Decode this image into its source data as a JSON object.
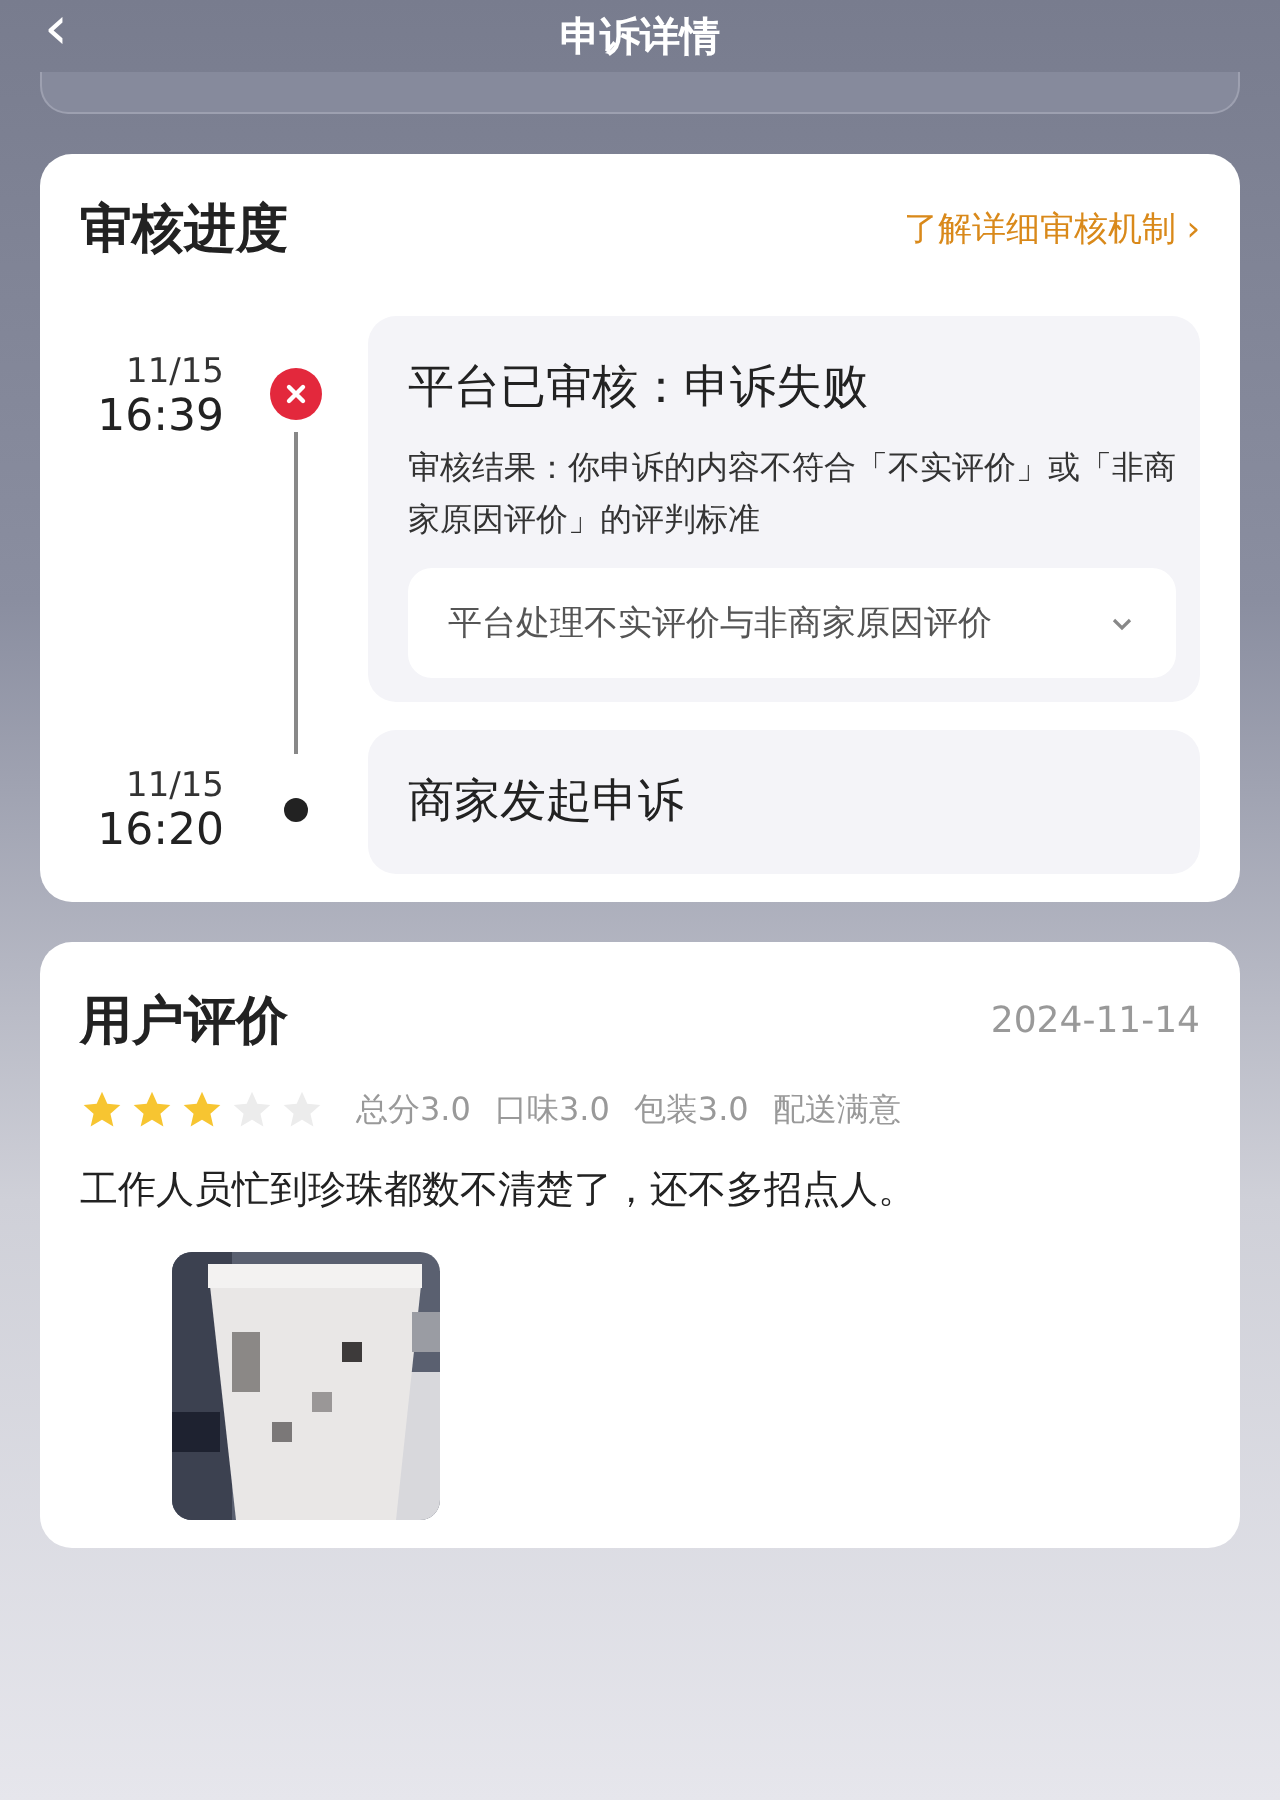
{
  "header": {
    "back": "‹",
    "title": "申诉详情"
  },
  "review_progress": {
    "title": "审核进度",
    "link": "了解详细审核机制 ›",
    "events": [
      {
        "date": "11/15",
        "time": "16:39",
        "kind": "failed",
        "title": "平台已审核：申诉失败",
        "detail": "审核结果：你申诉的内容不符合「不实评价」或「非商家原因评价」的评判标准",
        "dropdown": {
          "label": "平台处理不实评价与非商家原因评价",
          "expanded": false
        }
      },
      {
        "date": "11/15",
        "time": "16:20",
        "kind": "normal",
        "title": "商家发起申诉"
      }
    ]
  },
  "user_review": {
    "title": "用户评价",
    "date": "2024-11-14",
    "stars": 3,
    "scores": [
      "总分3.0",
      "口味3.0",
      "包装3.0",
      "配送满意"
    ],
    "text": "工作人员忙到珍珠都数不清楚了，还不多招点人。",
    "photos": [
      {
        "kind": "picture"
      }
    ]
  }
}
